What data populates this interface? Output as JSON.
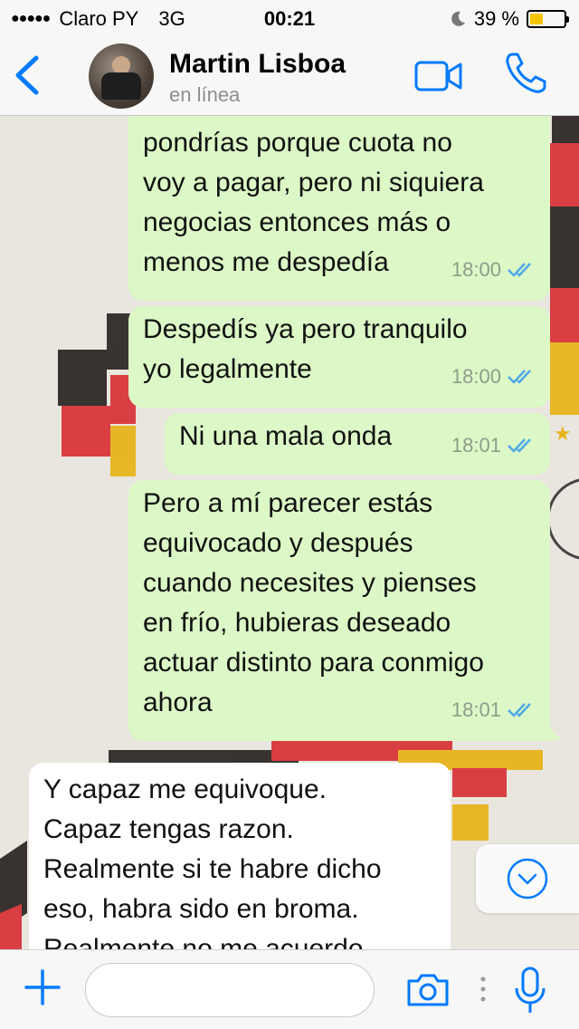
{
  "status_bar": {
    "signal": "●●●●●",
    "carrier": "Claro PY",
    "network": "3G",
    "time": "00:21",
    "battery_percent": "39 %",
    "battery_level": 0.39,
    "icons": [
      "moon-icon",
      "battery-icon"
    ]
  },
  "header": {
    "contact_name": "Martin Lisboa",
    "contact_status": "en línea",
    "icons": [
      "back-chevron-icon",
      "video-call-icon",
      "phone-call-icon"
    ],
    "accent_color": "#007aff"
  },
  "messages": [
    {
      "direction": "out",
      "text": "pondrías porque cuota no\nvoy a pagar, pero ni siquiera\nnegocias entonces más o\nmenos me despedía",
      "time": "18:00",
      "status": "read"
    },
    {
      "direction": "out",
      "text": "Despedís ya pero tranquilo\nyo legalmente",
      "time": "18:00",
      "status": "read"
    },
    {
      "direction": "out",
      "text": "Ni una mala onda",
      "time": "18:01",
      "status": "read"
    },
    {
      "direction": "out",
      "text": "Pero a mí parecer estás\nequivocado y después\ncuando necesites y pienses\nen frío, hubieras deseado\nactuar distinto para conmigo\nahora",
      "time": "18:01",
      "status": "read"
    },
    {
      "direction": "in",
      "text": "Y capaz me equivoque.\nCapaz tengas razon.\nRealmente si te habre dicho\neso, habra sido en broma.\nRealmente no me acuerdo"
    }
  ],
  "colors": {
    "outgoing_bubble": "#dcf8c6",
    "incoming_bubble": "#ffffff",
    "read_ticks": "#4fa8e8"
  },
  "input_bar": {
    "placeholder": "",
    "icons": [
      "plus-icon",
      "camera-icon",
      "microphone-icon"
    ]
  }
}
